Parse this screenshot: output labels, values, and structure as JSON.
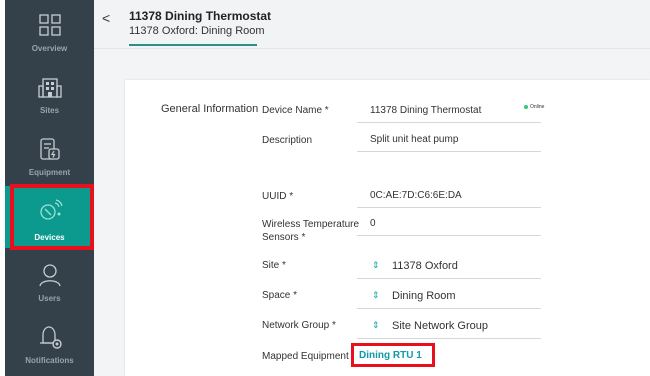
{
  "sidebar": {
    "items": [
      {
        "label": "Overview",
        "icon": "grid-icon"
      },
      {
        "label": "Sites",
        "icon": "building-icon"
      },
      {
        "label": "Equipment",
        "icon": "equipment-icon"
      },
      {
        "label": "Devices",
        "icon": "devices-icon",
        "active": true
      },
      {
        "label": "Users",
        "icon": "user-icon"
      },
      {
        "label": "Notifications",
        "icon": "bell-icon"
      }
    ]
  },
  "header": {
    "title": "11378 Dining Thermostat",
    "subtitle": "11378 Oxford: Dining Room",
    "back_glyph": "<"
  },
  "section": {
    "title": "General Information"
  },
  "fields": {
    "device_name": {
      "label": "Device Name *",
      "value": "11378 Dining Thermostat",
      "status": "Online"
    },
    "description": {
      "label": "Description",
      "value": "Split unit heat pump"
    },
    "uuid": {
      "label": "UUID *",
      "value": "0C:AE:7D:C6:6E:DA"
    },
    "wireless_sensors": {
      "label": "Wireless Temperature Sensors *",
      "value": "0"
    },
    "site": {
      "label": "Site *",
      "value": "11378 Oxford"
    },
    "space": {
      "label": "Space *",
      "value": "Dining Room"
    },
    "network_group": {
      "label": "Network Group *",
      "value": "Site Network Group"
    },
    "mapped_equipment": {
      "label": "Mapped Equipment",
      "value": "Dining RTU 1"
    }
  },
  "colors": {
    "sidebar_bg": "#34414a",
    "accent": "#0c9a8e",
    "link": "#0e9aa6",
    "online": "#2ecc71",
    "highlight": "#e8101a"
  }
}
